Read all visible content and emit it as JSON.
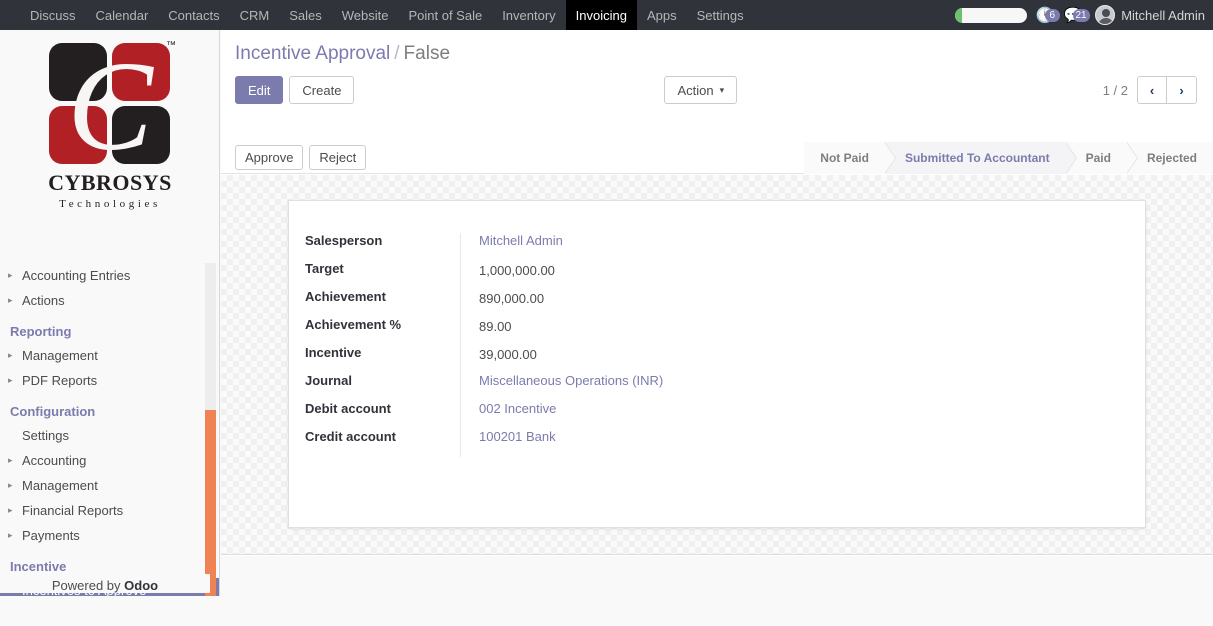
{
  "topbar": {
    "menu": [
      {
        "label": "Discuss",
        "active": false
      },
      {
        "label": "Calendar",
        "active": false
      },
      {
        "label": "Contacts",
        "active": false
      },
      {
        "label": "CRM",
        "active": false
      },
      {
        "label": "Sales",
        "active": false
      },
      {
        "label": "Website",
        "active": false
      },
      {
        "label": "Point of Sale",
        "active": false
      },
      {
        "label": "Inventory",
        "active": false
      },
      {
        "label": "Invoicing",
        "active": true
      },
      {
        "label": "Apps",
        "active": false
      },
      {
        "label": "Settings",
        "active": false
      }
    ],
    "activity_icon": "clock-icon",
    "activity_count": "6",
    "messages_icon": "chat-bubble-icon",
    "messages_count": "21",
    "avatar_icon": "user-avatar",
    "username": "Mitchell Admin",
    "accent_color": "#7c7bad",
    "navbar_color": "#31333a"
  },
  "sidebar": {
    "logo": {
      "name": "CYBROSYS",
      "subtitle": "Technologies",
      "trademark": "™",
      "letter": "C",
      "color_black": "#231f20",
      "color_red": "#b02025"
    },
    "items": [
      {
        "label": "Accounting Entries",
        "type": "item",
        "caret": true,
        "selected": false
      },
      {
        "label": "Actions",
        "type": "item",
        "caret": true,
        "selected": false
      },
      {
        "label": "Reporting",
        "type": "section",
        "caret": false,
        "selected": false
      },
      {
        "label": "Management",
        "type": "item",
        "caret": true,
        "selected": false
      },
      {
        "label": "PDF Reports",
        "type": "item",
        "caret": true,
        "selected": false
      },
      {
        "label": "Configuration",
        "type": "section",
        "caret": false,
        "selected": false
      },
      {
        "label": "Settings",
        "type": "item",
        "caret": false,
        "selected": false
      },
      {
        "label": "Accounting",
        "type": "item",
        "caret": true,
        "selected": false
      },
      {
        "label": "Management",
        "type": "item",
        "caret": true,
        "selected": false
      },
      {
        "label": "Financial Reports",
        "type": "item",
        "caret": true,
        "selected": false
      },
      {
        "label": "Payments",
        "type": "item",
        "caret": true,
        "selected": false
      },
      {
        "label": "Incentive",
        "type": "section",
        "caret": false,
        "selected": false
      },
      {
        "label": "Incentives to Approve",
        "type": "item",
        "caret": false,
        "selected": true
      }
    ],
    "powered_prefix": "Powered by ",
    "powered_brand": "Odoo",
    "scrollbar_thumb_color": "#ef8354"
  },
  "controlpanel": {
    "breadcrumb_root": "Incentive Approval",
    "breadcrumb_sep": "/",
    "breadcrumb_current": "False",
    "edit_label": "Edit",
    "create_label": "Create",
    "action_label": "Action",
    "action_caret": "▾",
    "pager_value": "1 / 2",
    "pager_prev_icon": "chevron-left-icon",
    "pager_prev_glyph": "‹",
    "pager_next_icon": "chevron-right-icon",
    "pager_next_glyph": "›"
  },
  "statusrow": {
    "approve_label": "Approve",
    "reject_label": "Reject",
    "stages": [
      {
        "label": "Not Paid",
        "active": false
      },
      {
        "label": "Submitted To Accountant",
        "active": true
      },
      {
        "label": "Paid",
        "active": false
      },
      {
        "label": "Rejected",
        "active": false
      }
    ]
  },
  "form": {
    "fields": [
      {
        "label": "Salesperson",
        "value": "Mitchell Admin",
        "kind": "link"
      },
      {
        "label": "Target",
        "value": "1,000,000.00",
        "kind": "number"
      },
      {
        "label": "Achievement",
        "value": "890,000.00",
        "kind": "number"
      },
      {
        "label": "Achievement %",
        "value": "89.00",
        "kind": "number"
      },
      {
        "label": "Incentive",
        "value": "39,000.00",
        "kind": "number"
      },
      {
        "label": "Journal",
        "value": "Miscellaneous Operations (INR)",
        "kind": "link"
      },
      {
        "label": "Debit account",
        "value": "002 Incentive",
        "kind": "link"
      },
      {
        "label": "Credit account",
        "value": "100201 Bank",
        "kind": "link"
      }
    ]
  }
}
